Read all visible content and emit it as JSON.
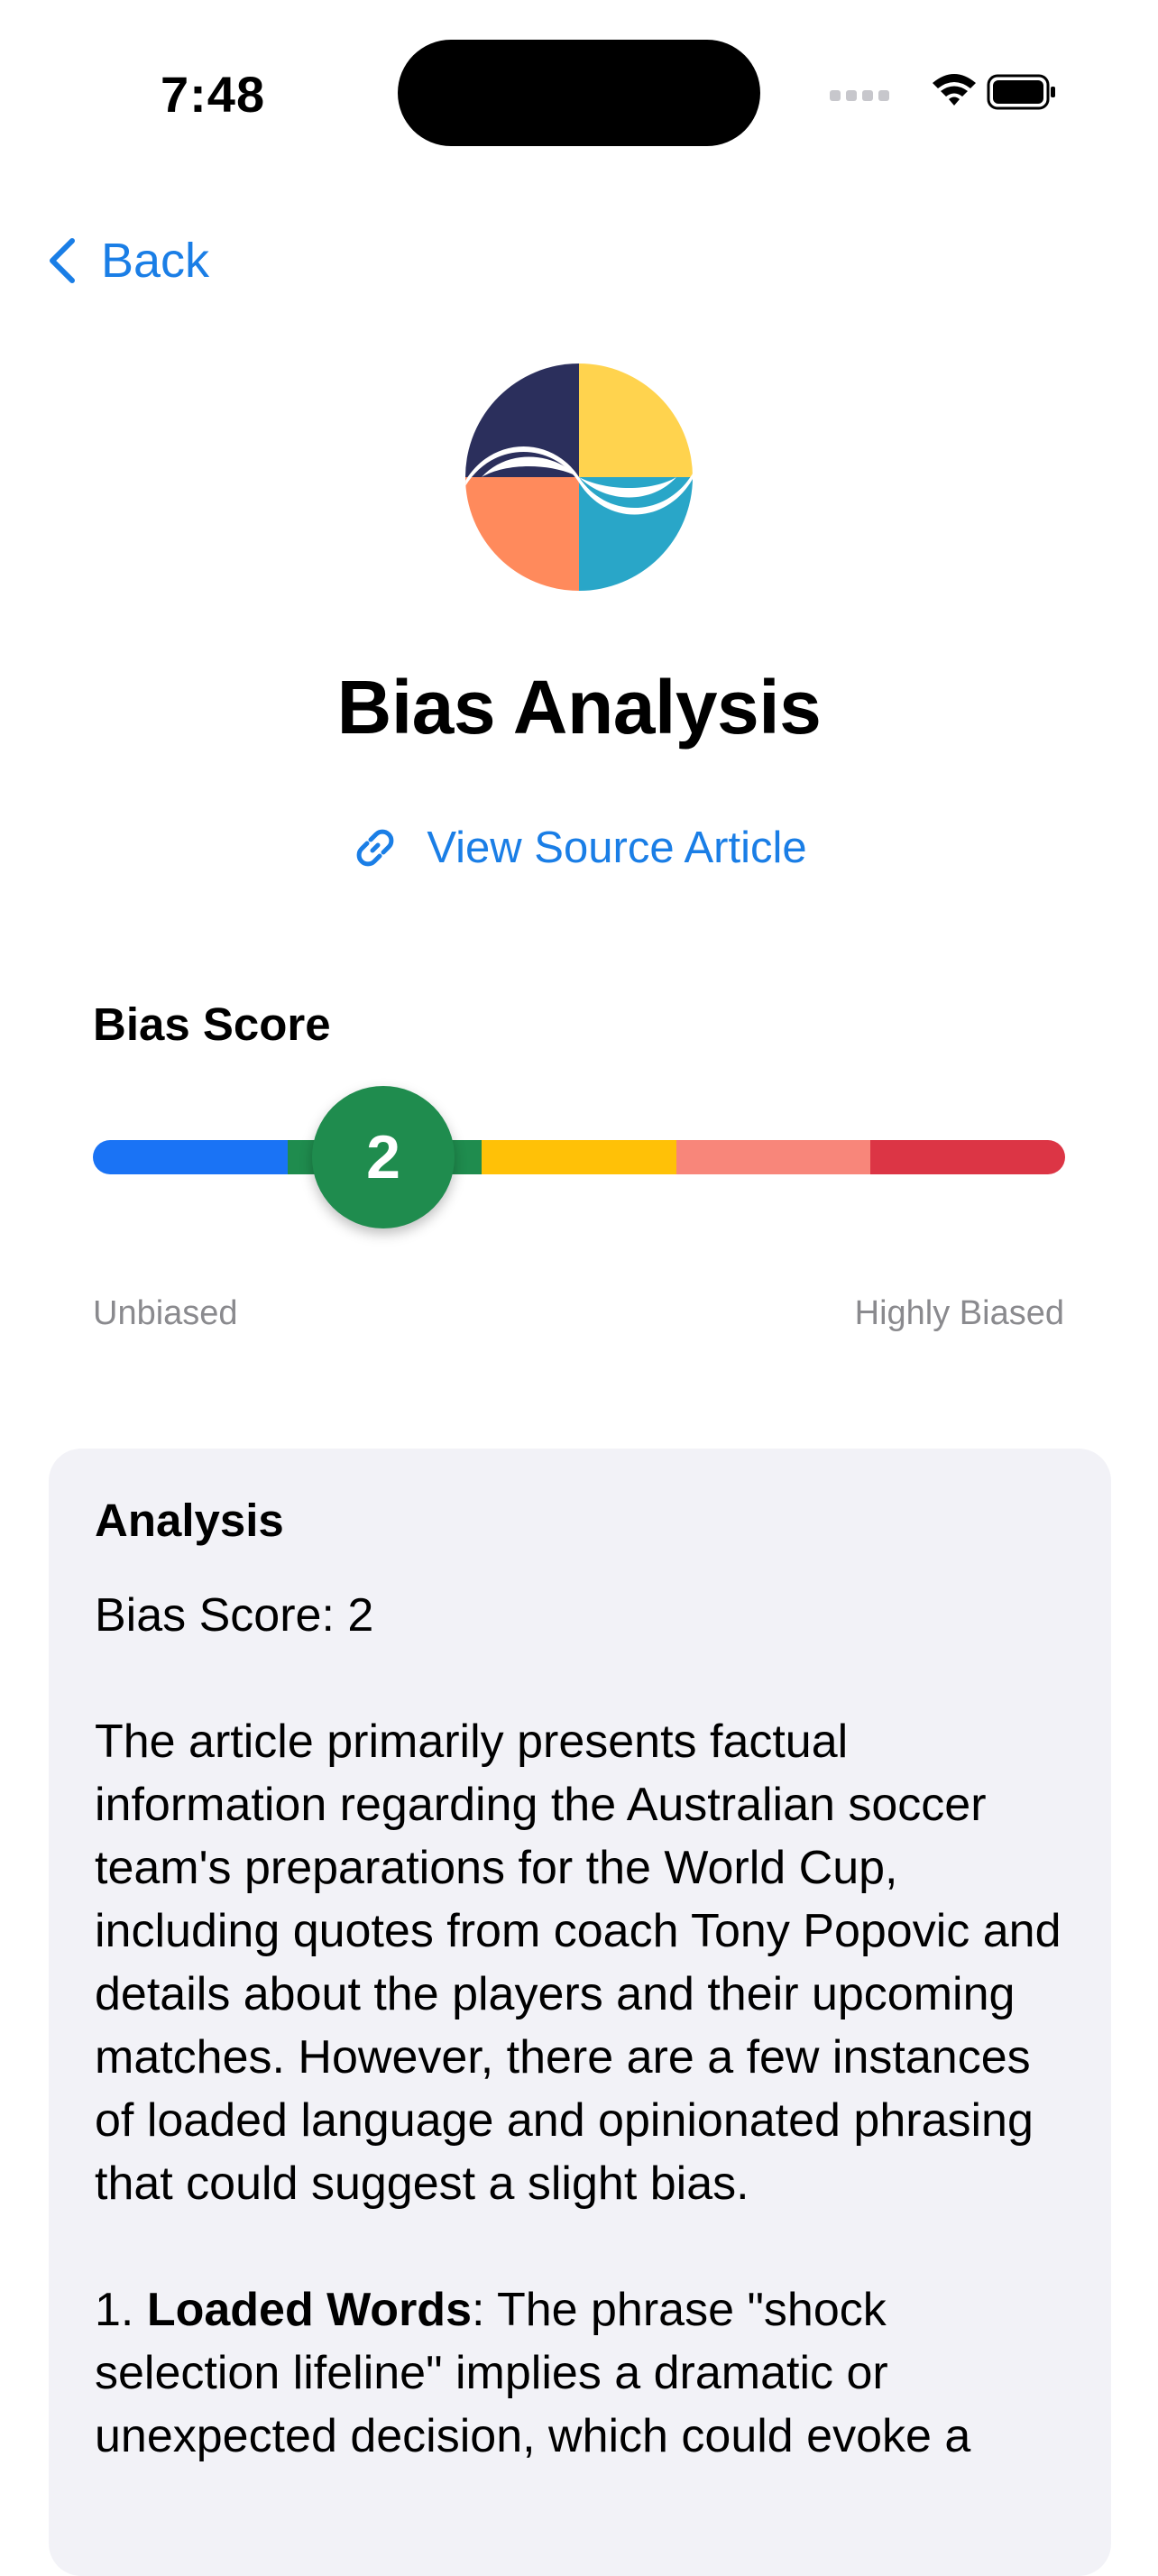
{
  "status_bar": {
    "time": "7:48"
  },
  "nav": {
    "back_label": "Back"
  },
  "header": {
    "title": "Bias Analysis",
    "source_link_label": "View Source Article"
  },
  "score": {
    "section_title": "Bias Score",
    "value": "2",
    "value_fraction": 0.3,
    "min_label": "Unbiased",
    "max_label": "Highly Biased",
    "scale_colors": [
      "#1a73f5",
      "#1f8c4e",
      "#ffc107",
      "#f8867a",
      "#dc3545"
    ]
  },
  "analysis": {
    "heading": "Analysis",
    "score_line": "Bias Score: 2",
    "paragraph": "The article primarily presents factual information regarding the Australian soccer team's preparations for the World Cup, including quotes from coach Tony Popovic and details about the players and their upcoming matches. However, there are a few instances of loaded language and opinionated phrasing that could suggest a slight bias.",
    "point_number": "1. ",
    "point_term": "Loaded Words",
    "point_text": ": The phrase \"shock selection lifeline\" implies a dramatic or unexpected decision, which could evoke a"
  },
  "colors": {
    "accent": "#1a7ee6",
    "card_background": "#f2f2f7",
    "logo_navy": "#2b2f5c",
    "logo_yellow": "#ffd34e",
    "logo_orange": "#ff8a5c",
    "logo_teal": "#29a6c8"
  },
  "icons": {
    "back": "chevron-left-icon",
    "link": "link-icon",
    "wifi": "wifi-icon",
    "battery": "battery-icon",
    "signal": "cellular-signal-icon"
  }
}
